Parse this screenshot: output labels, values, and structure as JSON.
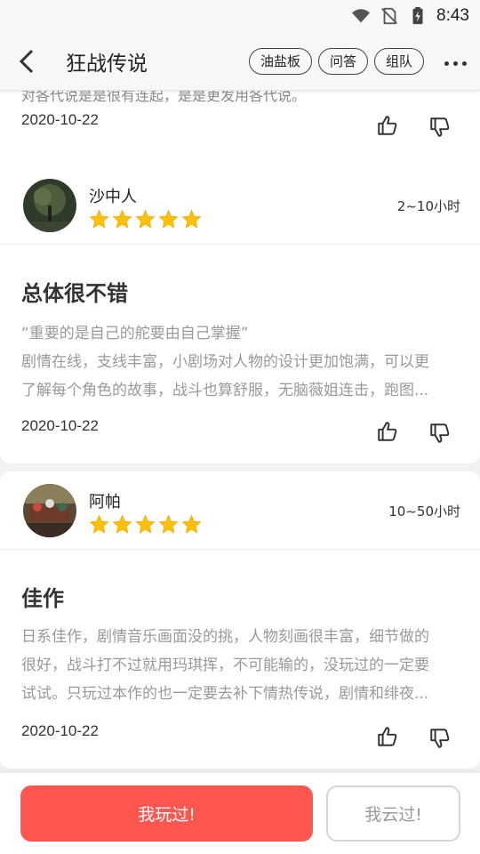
{
  "status_bar": {
    "time": "8:43",
    "icons": [
      "wifi-icon",
      "no-sim-icon",
      "battery-charging-icon"
    ]
  },
  "header": {
    "title": "狂战传说",
    "tags": [
      "油盐板",
      "问答",
      "组队"
    ],
    "icons": [
      "back-arrow-icon",
      "more-dots-icon"
    ]
  },
  "reviews": [
    {
      "cut_text": "对各代说是是很有连起，是是更发用各代说。",
      "date": "2020-10-22"
    },
    {
      "username": "沙中人",
      "stars": 5,
      "playtime": "2~10小时",
      "title": "总体很不错",
      "body": [
        "“重要的是自己的舵要由自己掌握”",
        "剧情在线，支线丰富，小剧场对人物的设计更加饱满，可以更",
        "了解每个角色的故事，战斗也算舒服，无脑薇姐连击，跑图..."
      ],
      "date": "2020-10-22"
    },
    {
      "username": "阿帕",
      "stars": 5,
      "playtime": "10~50小时",
      "title": "佳作",
      "body": [
        "日系佳作，剧情音乐画面没的挑，人物刻画很丰富，细节做的",
        "很好，战斗打不过就用玛琪挥，不可能输的，没玩过的一定要",
        "试试。只玩过本作的也一定要去补下情热传说，剧情和绯夜..."
      ],
      "date": "2020-10-22"
    }
  ],
  "bottom": {
    "played_label": "我玩过!",
    "cloud_label": "我云过!"
  },
  "colors": {
    "accent": "#ff5750",
    "star": "#ffc107",
    "background": "#f2f2f2"
  }
}
